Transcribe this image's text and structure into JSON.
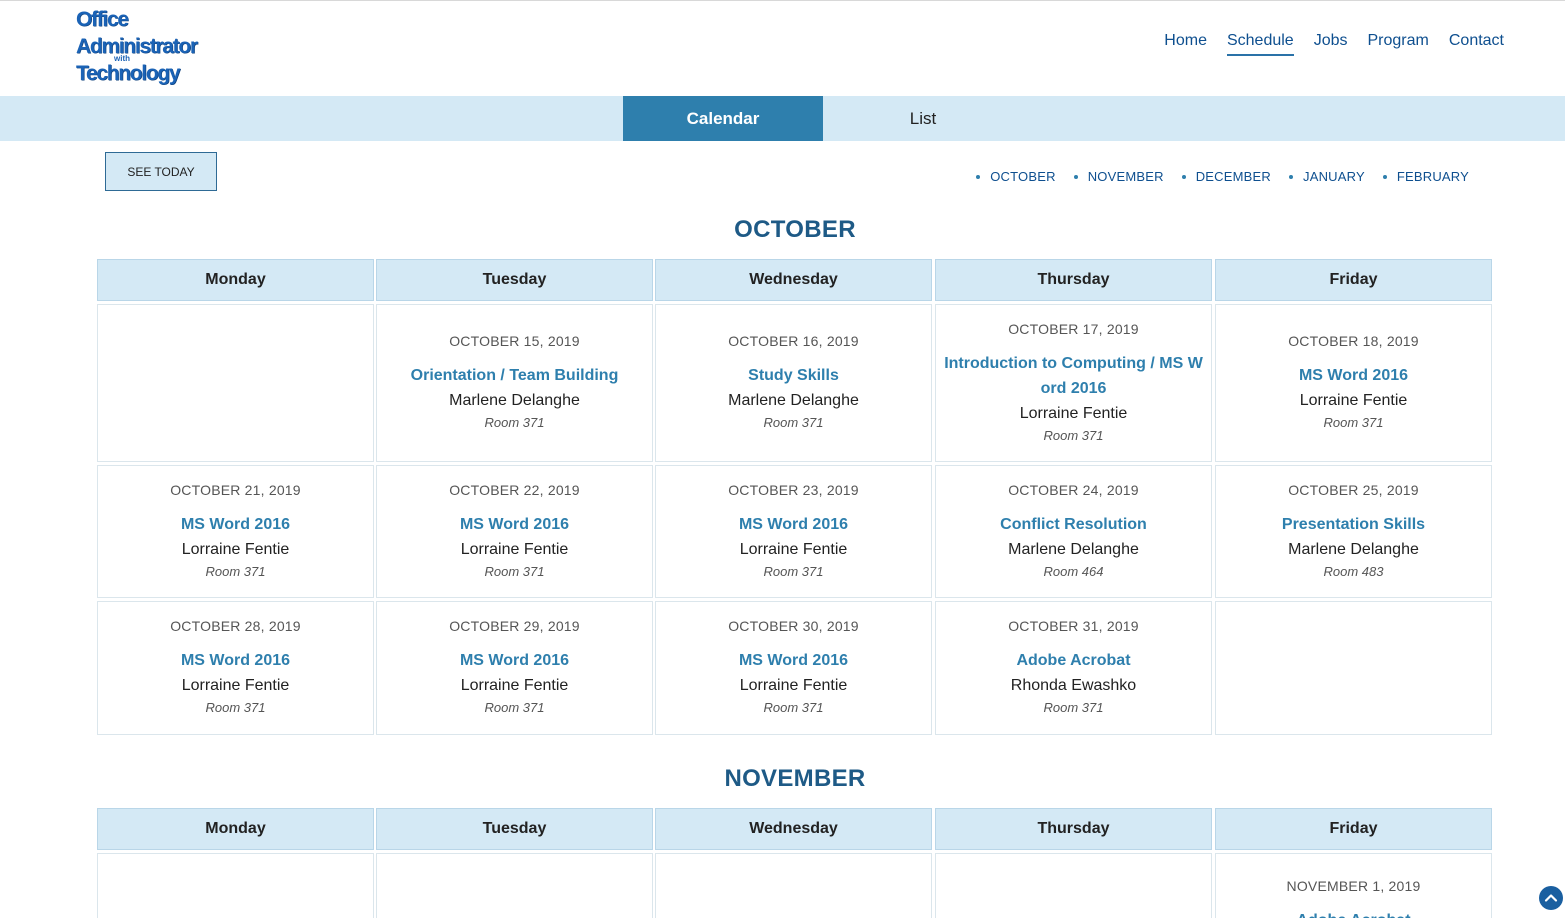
{
  "logo": {
    "line1": "Office",
    "line2": "Administrator",
    "line3": "with",
    "line4": "Technology"
  },
  "nav": [
    {
      "label": "Home",
      "active": false
    },
    {
      "label": "Schedule",
      "active": true
    },
    {
      "label": "Jobs",
      "active": false
    },
    {
      "label": "Program",
      "active": false
    },
    {
      "label": "Contact",
      "active": false
    }
  ],
  "view_tabs": {
    "calendar": "Calendar",
    "list": "List",
    "active": "calendar"
  },
  "see_today": "SEE TODAY",
  "month_links": [
    "OCTOBER",
    "NOVEMBER",
    "DECEMBER",
    "JANUARY",
    "FEBRUARY"
  ],
  "weekdays": [
    "Monday",
    "Tuesday",
    "Wednesday",
    "Thursday",
    "Friday"
  ],
  "october": {
    "title": "OCTOBER",
    "weeks": [
      [
        null,
        {
          "date": "OCTOBER 15, 2019",
          "course": "Orientation / Team Building",
          "teacher": "Marlene Delanghe",
          "room": "Room 371"
        },
        {
          "date": "OCTOBER 16, 2019",
          "course": "Study Skills",
          "teacher": "Marlene Delanghe",
          "room": "Room 371"
        },
        {
          "date": "OCTOBER 17, 2019",
          "course": "Introduction to Computing / MS Word 2016",
          "teacher": "Lorraine Fentie",
          "room": "Room 371"
        },
        {
          "date": "OCTOBER 18, 2019",
          "course": "MS Word 2016",
          "teacher": "Lorraine Fentie",
          "room": "Room 371"
        }
      ],
      [
        {
          "date": "OCTOBER 21, 2019",
          "course": "MS Word 2016",
          "teacher": "Lorraine Fentie",
          "room": "Room 371"
        },
        {
          "date": "OCTOBER 22, 2019",
          "course": "MS Word 2016",
          "teacher": "Lorraine Fentie",
          "room": "Room 371"
        },
        {
          "date": "OCTOBER 23, 2019",
          "course": "MS Word 2016",
          "teacher": "Lorraine Fentie",
          "room": "Room 371"
        },
        {
          "date": "OCTOBER 24, 2019",
          "course": "Conflict Resolution",
          "teacher": "Marlene Delanghe",
          "room": "Room 464"
        },
        {
          "date": "OCTOBER 25, 2019",
          "course": "Presentation Skills",
          "teacher": "Marlene Delanghe",
          "room": "Room 483"
        }
      ],
      [
        {
          "date": "OCTOBER 28, 2019",
          "course": "MS Word 2016",
          "teacher": "Lorraine Fentie",
          "room": "Room 371"
        },
        {
          "date": "OCTOBER 29, 2019",
          "course": "MS Word 2016",
          "teacher": "Lorraine Fentie",
          "room": "Room 371"
        },
        {
          "date": "OCTOBER 30, 2019",
          "course": "MS Word 2016",
          "teacher": "Lorraine Fentie",
          "room": "Room 371"
        },
        {
          "date": "OCTOBER 31, 2019",
          "course": "Adobe Acrobat",
          "teacher": "Rhonda Ewashko",
          "room": "Room 371"
        },
        null
      ]
    ]
  },
  "november": {
    "title": "NOVEMBER",
    "weeks": [
      [
        null,
        null,
        null,
        null,
        {
          "date": "NOVEMBER 1, 2019",
          "course": "Adobe Acrobat",
          "teacher": "",
          "room": ""
        }
      ]
    ]
  },
  "colors": {
    "accent": "#2e7fad",
    "tab_bg": "#d4e9f5",
    "nav_text": "#0e4f8f",
    "month_title": "#1e5a86"
  },
  "icons": {
    "scroll_top": "chevron-up-icon"
  }
}
